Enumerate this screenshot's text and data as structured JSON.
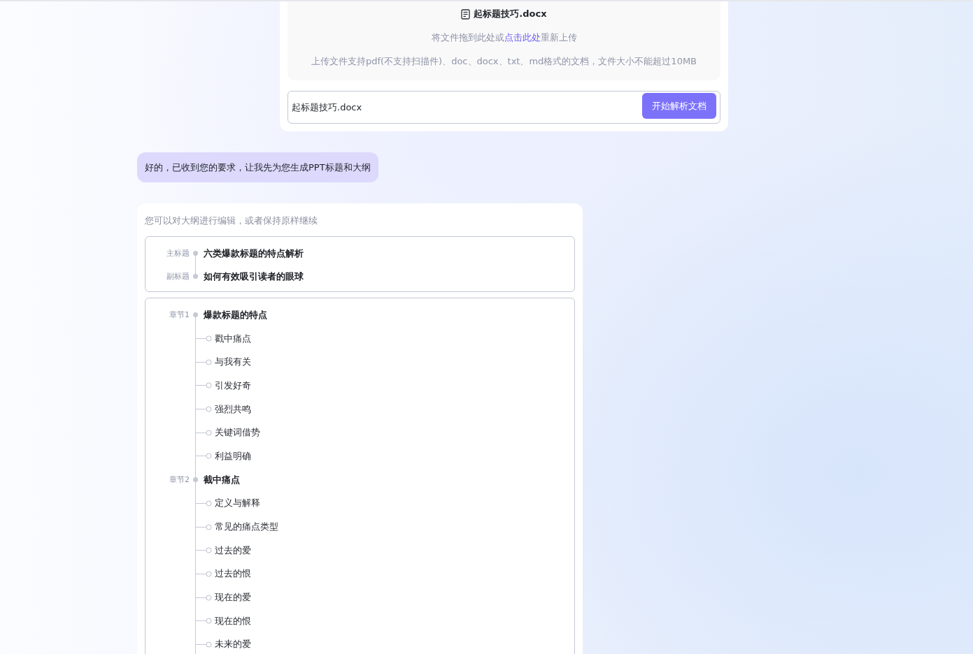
{
  "upload": {
    "file_name": "起标题技巧.docx",
    "instruction": {
      "before": "将文件拖到此处或",
      "link": "点击此处",
      "after": "重新上传"
    },
    "hint": "上传文件支持pdf(不支持扫描件)、doc、docx、txt、md格式的文档，文件大小不能超过10MB",
    "input": {
      "value": "起标题技巧.docx"
    },
    "button": "开始解析文档"
  },
  "assistant_message": {
    "text": "好的，已收到您的要求，让我先为您生成PPT标题和大纲"
  },
  "outline": {
    "hint": "您可以对大纲进行编辑，或者保持原样继续",
    "titles": [
      {
        "label": "主标题",
        "text": "六类爆款标题的特点解析"
      },
      {
        "label": "副标题",
        "text": "如何有效吸引读者的眼球"
      }
    ],
    "chapters": [
      {
        "label": "章节1",
        "title": "爆款标题的特点",
        "children": [
          {
            "title": "戳中痛点"
          },
          {
            "title": "与我有关"
          },
          {
            "title": "引发好奇"
          },
          {
            "title": "强烈共鸣"
          },
          {
            "title": "关键词借势"
          },
          {
            "title": "利益明确"
          }
        ]
      },
      {
        "label": "章节2",
        "title": "截中痛点",
        "children": [
          {
            "title": "定义与解释"
          },
          {
            "title": "常见的痛点类型"
          },
          {
            "title": "过去的爱"
          },
          {
            "title": "过去的恨"
          },
          {
            "title": "现在的爱"
          },
          {
            "title": "现在的恨"
          },
          {
            "title": "未来的爱"
          }
        ]
      }
    ]
  }
}
